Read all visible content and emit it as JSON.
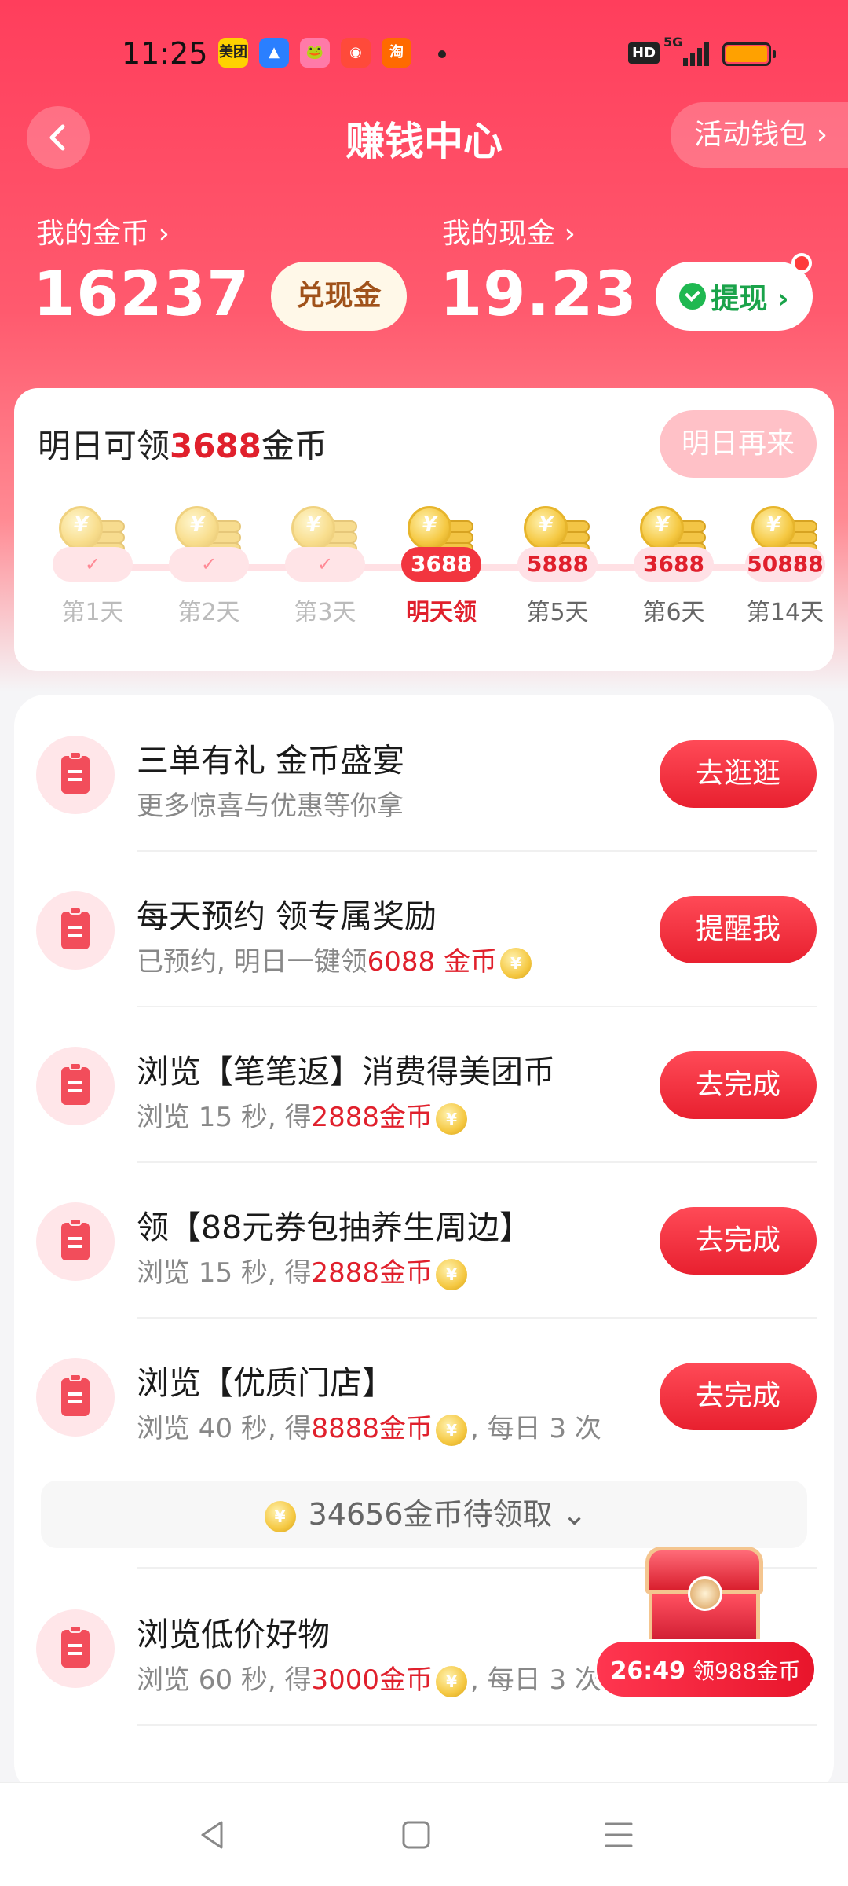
{
  "status_bar": {
    "time": "11:25",
    "app_icons": [
      {
        "name": "meituan-icon",
        "text": "美团",
        "color": "#ffd100",
        "fg": "#222"
      },
      {
        "name": "android-icon",
        "text": "▲",
        "color": "#2a7fff",
        "fg": "#fff"
      },
      {
        "name": "frog-app-icon",
        "text": "🐸",
        "color": "#ff7aa8",
        "fg": "#fff"
      },
      {
        "name": "map-pin-app-icon",
        "text": "◉",
        "color": "#ff4a3a",
        "fg": "#fff"
      },
      {
        "name": "taobao-icon",
        "text": "淘",
        "color": "#ff6a00",
        "fg": "#fff"
      }
    ],
    "hd": "HD",
    "network": "5G"
  },
  "header": {
    "title": "赚钱中心",
    "wallet_link": "活动钱包 ›"
  },
  "balance": {
    "coins_label": "我的金币 ›",
    "coins_value": "16237",
    "exchange_button": "兑现金",
    "cash_label": "我的现金 ›",
    "cash_value": "19.23",
    "withdraw_button": "提现 ›"
  },
  "checkin": {
    "prefix": "明日可领",
    "amount": "3688",
    "suffix": "金币",
    "come_back_button": "明日再来",
    "days": [
      {
        "label": "第1天",
        "state": "done",
        "value": "✓"
      },
      {
        "label": "第2天",
        "state": "done",
        "value": "✓"
      },
      {
        "label": "第3天",
        "state": "done",
        "value": "✓"
      },
      {
        "label": "明天领",
        "state": "today",
        "value": "3688"
      },
      {
        "label": "第5天",
        "state": "future",
        "value": "5888"
      },
      {
        "label": "第6天",
        "state": "future",
        "value": "3688"
      },
      {
        "label": "第14天",
        "state": "future",
        "value": "50888"
      }
    ]
  },
  "tasks": [
    {
      "title": "三单有礼 金币盛宴",
      "sub_pre": "更多惊喜与优惠等你拿",
      "sub_red": "",
      "sub_post": "",
      "coin": false,
      "button": "去逛逛"
    },
    {
      "title": "每天预约 领专属奖励",
      "sub_pre": "已预约, 明日一键领",
      "sub_red": "6088 金币",
      "sub_post": "",
      "coin": true,
      "button": "提醒我"
    },
    {
      "title": "浏览【笔笔返】消费得美团币",
      "sub_pre": "浏览 15 秒, 得",
      "sub_red": "2888金币",
      "sub_post": "",
      "coin": true,
      "button": "去完成"
    },
    {
      "title": "领【88元券包抽养生周边】",
      "sub_pre": "浏览 15 秒, 得",
      "sub_red": "2888金币",
      "sub_post": "",
      "coin": true,
      "button": "去完成"
    },
    {
      "title": "浏览【优质门店】",
      "sub_pre": "浏览 40 秒, 得",
      "sub_red": "8888金币",
      "sub_post": ", 每日 3 次",
      "coin": true,
      "button": "去完成"
    },
    {
      "title": "浏览低价好物",
      "sub_pre": "浏览 60 秒, 得",
      "sub_red": "3000金币",
      "sub_post": ", 每日 3 次",
      "coin": true,
      "button": ""
    }
  ],
  "pending": {
    "text": "34656金币待领取",
    "chevron": "⌄"
  },
  "floating": {
    "timer": "26:49",
    "reward": "领988金币"
  },
  "colors": {
    "brand_red": "#e8202f",
    "hero_gradient_top": "#ff3e5c",
    "coin_gold": "#f5c842"
  }
}
